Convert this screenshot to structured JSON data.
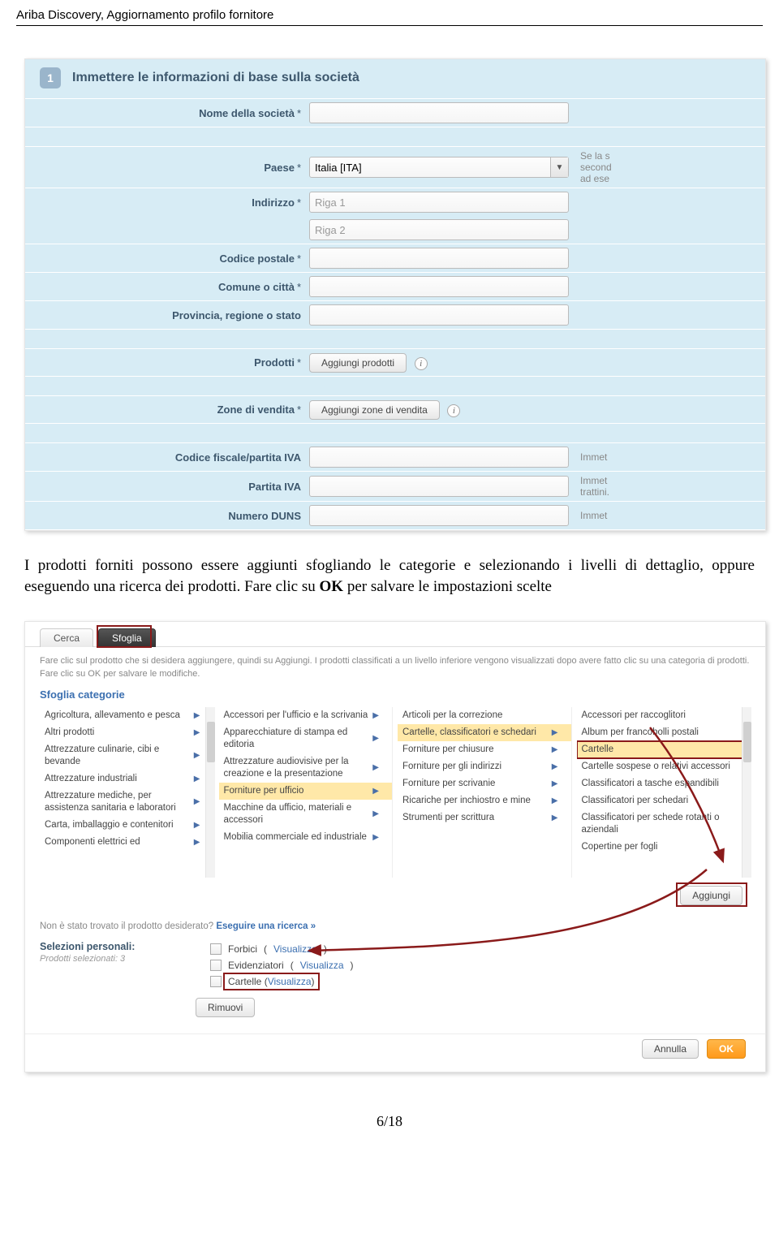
{
  "doc_header": "Ariba Discovery, Aggiornamento profilo fornitore",
  "form": {
    "step_number": "1",
    "step_title": "Immettere le informazioni di base sulla società",
    "labels": {
      "company_name": "Nome della società",
      "country": "Paese",
      "address": "Indirizzo",
      "postal_code": "Codice postale",
      "city": "Comune o città",
      "province": "Provincia, regione o stato",
      "products": "Prodotti",
      "sales_zones": "Zone di vendita",
      "fiscal_code": "Codice fiscale/partita IVA",
      "vat": "Partita IVA",
      "duns": "Numero DUNS"
    },
    "values": {
      "country": "Italia  [ITA]",
      "address_placeholder_1": "Riga 1",
      "address_placeholder_2": "Riga 2"
    },
    "buttons": {
      "add_products": "Aggiungi prodotti",
      "add_zones": "Aggiungi zone di vendita"
    },
    "help": {
      "country_1": "Se la s",
      "country_2": "second",
      "country_3": "ad ese",
      "fiscal": "Immet",
      "vat1": "Immet",
      "vat2": "trattini.",
      "duns": "Immet"
    }
  },
  "body_paragraph": "I prodotti forniti possono essere aggiunti sfogliando le categorie e selezionando i livelli di dettaglio, oppure eseguendo una ricerca dei prodotti. Fare clic su OK per salvare le impostazioni scelte",
  "browser": {
    "tabs": {
      "search": "Cerca",
      "browse": "Sfoglia"
    },
    "instruction": "Fare clic sul prodotto che si desidera aggiungere, quindi su Aggiungi. I prodotti classificati a un livello inferiore vengono visualizzati dopo avere fatto clic su una categoria di prodotti. Fare clic su OK per salvare le modifiche.",
    "subhead": "Sfoglia categorie",
    "col1": [
      "Agricoltura, allevamento e pesca",
      "Altri prodotti",
      "Attrezzature culinarie, cibi e bevande",
      "Attrezzature industriali",
      "Attrezzature mediche, per assistenza sanitaria e laboratori",
      "Carta, imballaggio e contenitori",
      "Componenti elettrici ed"
    ],
    "col2": [
      "Accessori per l'ufficio e la scrivania",
      "Apparecchiature di stampa ed editoria",
      "Attrezzature audiovisive per la creazione e la presentazione",
      "Forniture per ufficio",
      "Macchine da ufficio, materiali e accessori",
      "Mobilia commerciale ed industriale"
    ],
    "col3": [
      "Articoli per la correzione",
      "Cartelle, classificatori e schedari",
      "Forniture per chiusure",
      "Forniture per gli indirizzi",
      "Forniture per scrivanie",
      "Ricariche per inchiostro e mine",
      "Strumenti per scrittura"
    ],
    "col4": [
      "Accessori per raccoglitori",
      "Album per francobolli postali",
      "Cartelle",
      "Cartelle sospese o relativi accessori",
      "Classificatori a tasche espandibili",
      "Classificatori per schedari",
      "Classificatori per schede rotanti o aziendali",
      "Copertine per fogli"
    ],
    "add_button": "Aggiungi",
    "not_found_text": "Non è stato trovato il prodotto desiderato?  ",
    "not_found_link": "Eseguire una ricerca »",
    "selections_title": "Selezioni personali:",
    "selections_sub": "Prodotti selezionati: 3",
    "selections": [
      "Forbici",
      "Evidenziatori",
      "Cartelle"
    ],
    "visualizza": "Visualizza",
    "remove_button": "Rimuovi",
    "cancel_button": "Annulla",
    "ok_button": "OK"
  },
  "page_number": "6/18"
}
